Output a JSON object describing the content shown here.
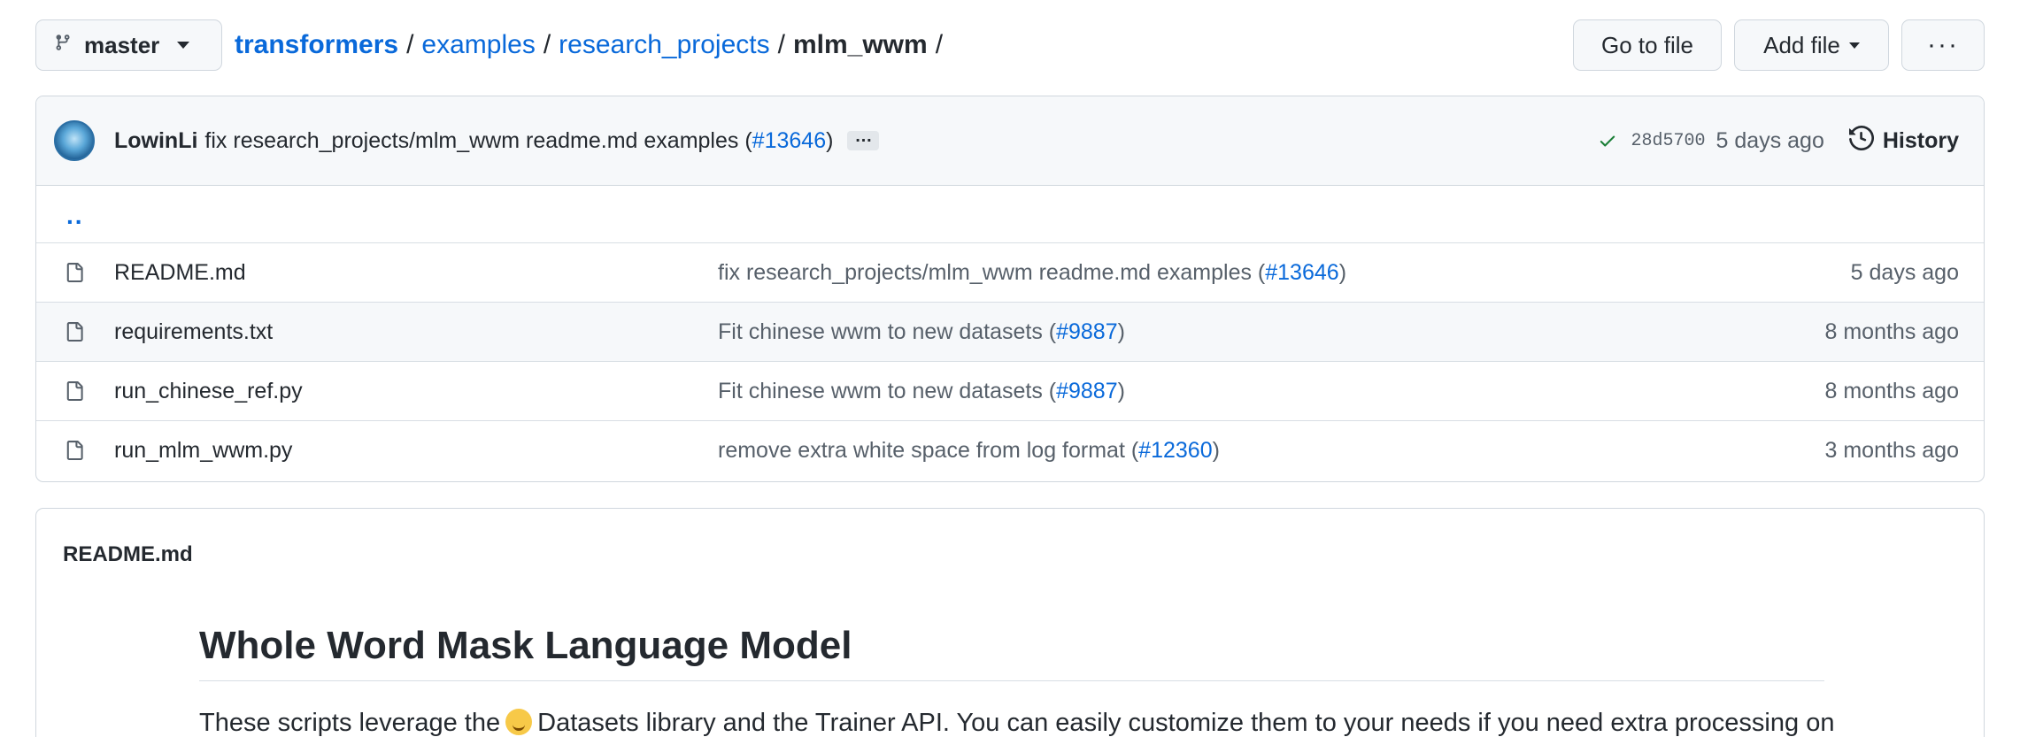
{
  "branch": {
    "name": "master"
  },
  "breadcrumb": {
    "repo": "transformers",
    "parts": [
      "examples",
      "research_projects"
    ],
    "current": "mlm_wwm",
    "separator": "/"
  },
  "actions": {
    "go_to_file": "Go to file",
    "add_file": "Add file",
    "more": "···"
  },
  "latest_commit": {
    "author": "LowinLi",
    "message_prefix": "fix research_projects/mlm_wwm readme.md examples (",
    "pr": "#13646",
    "message_suffix": ")",
    "expand": "…",
    "status_icon": "check-icon",
    "status_color": "#1a7f37",
    "sha": "28d5700",
    "age": "5 days ago",
    "history_label": "History"
  },
  "files": {
    "parent": "..",
    "rows": [
      {
        "name": "README.md",
        "msg_prefix": "fix research_projects/mlm_wwm readme.md examples (",
        "pr": "#13646",
        "msg_suffix": ")",
        "age": "5 days ago"
      },
      {
        "name": "requirements.txt",
        "msg_prefix": "Fit chinese wwm to new datasets (",
        "pr": "#9887",
        "msg_suffix": ")",
        "age": "8 months ago"
      },
      {
        "name": "run_chinese_ref.py",
        "msg_prefix": "Fit chinese wwm to new datasets (",
        "pr": "#9887",
        "msg_suffix": ")",
        "age": "8 months ago"
      },
      {
        "name": "run_mlm_wwm.py",
        "msg_prefix": "remove extra white space from log format (",
        "pr": "#12360",
        "msg_suffix": ")",
        "age": "3 months ago"
      }
    ]
  },
  "readme": {
    "filename": "README.md",
    "heading": "Whole Word Mask Language Model",
    "para_start": "These scripts leverage the",
    "para_end": "Datasets library and the Trainer API. You can easily customize them to your needs if you need extra processing on"
  },
  "colors": {
    "link": "#0969da",
    "border": "#d0d7de",
    "muted": "#57606a"
  }
}
